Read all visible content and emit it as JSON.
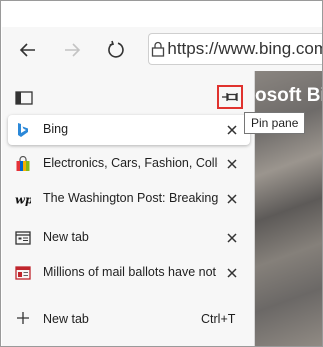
{
  "toolbar": {
    "address_url": "https://www.bing.com"
  },
  "page": {
    "title_fragment": "osoft Bin"
  },
  "pane": {
    "tabs": [
      {
        "title": "Bing",
        "icon": "bing-icon",
        "active": true
      },
      {
        "title": "Electronics, Cars, Fashion, Collectibles & More | eBay",
        "icon": "ebay-icon",
        "active": false
      },
      {
        "title": "The Washington Post: Breaking News",
        "icon": "washington-post-icon",
        "active": false
      },
      {
        "title": "New tab",
        "icon": "new-tab-page-icon",
        "active": false
      },
      {
        "title": "Millions of mail ballots have not been returned",
        "icon": "news-icon",
        "active": false
      }
    ],
    "new_tab_label": "New tab",
    "new_tab_shortcut": "Ctrl+T"
  },
  "tooltip": {
    "text": "Pin pane"
  },
  "colors": {
    "pin_highlight": "#e0322e",
    "bing_blue": "#2b88d8",
    "pane_background": "#f7f7f7"
  }
}
